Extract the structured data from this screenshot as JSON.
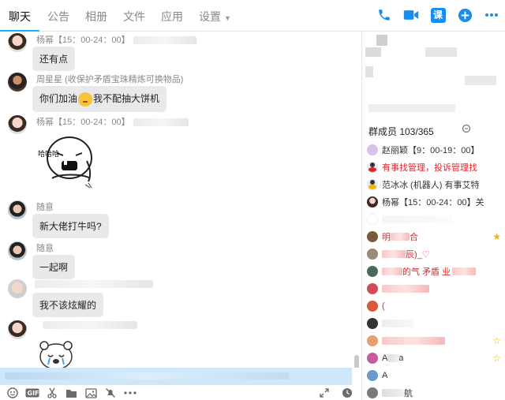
{
  "tabs": [
    "聊天",
    "公告",
    "相册",
    "文件",
    "应用",
    "设置"
  ],
  "tools": {
    "phone_icon": "phone-icon",
    "video_icon": "video-icon",
    "class_label": "课",
    "add_icon": "plus-icon",
    "more_icon": "more-icon"
  },
  "messages": [
    {
      "name": "杨幂【15：00-24：00】",
      "text": "还有点"
    },
    {
      "name": "周星星 (收保护矛盾宝珠精炼可换物品)",
      "text_before": "你们加油",
      "text_after": "我不配抽大饼机"
    },
    {
      "name": "杨幂【15：00-24：00】",
      "sticker_text": "哈哈哈"
    },
    {
      "name": "随意",
      "text": "新大佬打牛吗?"
    },
    {
      "name": "随意",
      "text": "一起啊"
    },
    {
      "name": "",
      "text": "我不该炫耀的"
    },
    {
      "name": "",
      "sticker_text": ""
    }
  ],
  "members": {
    "title": "群成员 103/365",
    "list": [
      {
        "name": "赵丽颖【9：00-19：00】",
        "red": false
      },
      {
        "name": "有事找管理，投诉管理找",
        "red": true
      },
      {
        "name": "范冰冰 (机器人) 有事艾特",
        "red": false
      },
      {
        "name": "杨幂【15：00-24：00】关",
        "red": false
      },
      {
        "name": "",
        "red": false
      },
      {
        "name": "明",
        "suffix": "合",
        "red": true
      },
      {
        "name": "",
        "suffix": "辰)_♡",
        "red": true
      },
      {
        "name": "",
        "suffix": "的气 矛盾 业",
        "red": true
      },
      {
        "name": "",
        "red": false
      },
      {
        "name": "(",
        "red": false
      },
      {
        "name": "",
        "red": false
      },
      {
        "name": "",
        "red": true
      },
      {
        "name": "A",
        "suffix": "a",
        "red": false
      },
      {
        "name": "A",
        "red": false
      },
      {
        "name": "",
        "suffix": "航",
        "red": false
      }
    ]
  },
  "colors": {
    "accent": "#12b7f5",
    "blue": "#1a8cf0",
    "bubble": "#e9e9eb",
    "red": "#e0262a"
  }
}
